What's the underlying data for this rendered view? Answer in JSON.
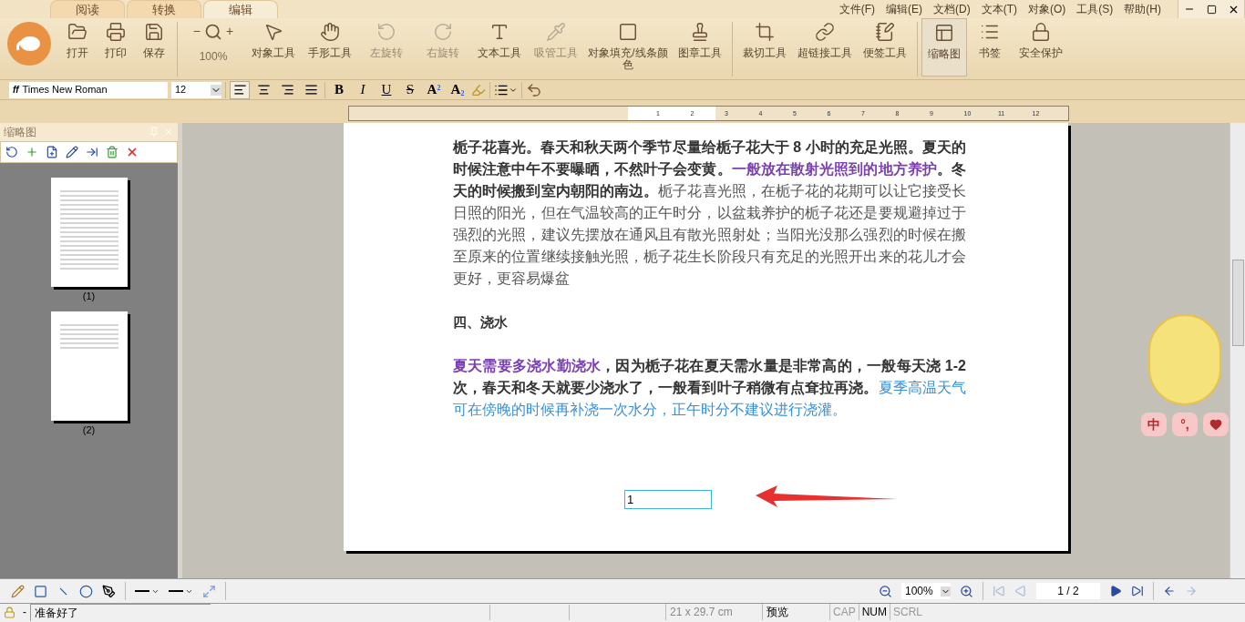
{
  "mode_tabs": [
    {
      "label": "阅读",
      "selected": false
    },
    {
      "label": "转换",
      "selected": false
    },
    {
      "label": "编辑",
      "selected": true
    }
  ],
  "menu": [
    "文件(F)",
    "编辑(E)",
    "文档(D)",
    "文本(T)",
    "对象(O)",
    "工具(S)",
    "帮助(H)"
  ],
  "toolbar": {
    "file_tools": [
      {
        "label": "打开"
      },
      {
        "label": "打印"
      },
      {
        "label": "保存"
      }
    ],
    "zoom": {
      "minus": "−",
      "plus": "+",
      "value": "100%"
    },
    "tools": [
      {
        "label": "对象工具",
        "disabled": false
      },
      {
        "label": "手形工具",
        "disabled": false
      },
      {
        "label": "左旋转",
        "disabled": true
      },
      {
        "label": "右旋转",
        "disabled": true
      },
      {
        "label": "文本工具",
        "disabled": false
      },
      {
        "label": "吸管工具",
        "disabled": true
      },
      {
        "label": "对象填充/线条颜色",
        "disabled": false
      },
      {
        "label": "图章工具",
        "disabled": false
      }
    ],
    "edit_tools": [
      {
        "label": "裁切工具"
      },
      {
        "label": "超链接工具"
      },
      {
        "label": "便签工具"
      }
    ],
    "view_tools": [
      {
        "label": "缩略图",
        "selected": true
      },
      {
        "label": "书签",
        "selected": false
      },
      {
        "label": "安全保护",
        "selected": false
      }
    ]
  },
  "format_bar": {
    "font_icon": "ff",
    "font": "Times New Roman",
    "size": "12",
    "align": [
      {
        "selected": true
      },
      {
        "selected": false
      },
      {
        "selected": false
      },
      {
        "selected": false
      }
    ],
    "bold": "B",
    "italic": "I",
    "underline": "U",
    "strike": "S",
    "superscript": "A",
    "super_mark": "2",
    "subscript": "A",
    "sub_mark": "2"
  },
  "ruler": [
    "1",
    "2",
    "3",
    "4",
    "5",
    "6",
    "7",
    "8",
    "9",
    "10",
    "11",
    "12"
  ],
  "sidebar": {
    "title": "缩略图",
    "pages": [
      {
        "label": "(1)",
        "selected": false
      },
      {
        "label": "(2)",
        "selected": false
      }
    ]
  },
  "document": {
    "paragraphs": [
      {
        "kind": "body",
        "segments": [
          {
            "kind": "bold",
            "text": "栀子花喜光。春天和秋天两个季节尽量给栀子花大于 8 小时的充足光照。夏天的时候注意中午不要曝晒，不然叶子会变黄。"
          },
          {
            "kind": "purple",
            "text": "一般放在散射光照到的地方养护"
          },
          {
            "kind": "bold",
            "text": "。冬天的时候搬到室内朝阳的南边。"
          },
          {
            "kind": "plain",
            "text": "栀子花喜光照，在栀子花的花期可以让它接受长日照的阳光，但在气温较高的正午时分，以盆栽养护的栀子花还是要规避掉过于强烈的光照，建议先摆放在通风且有散光照射处；当阳光没那么强烈的时候在搬至原来的位置继续接触光照，栀子花生长阶段只有充足的光照开出来的花儿才会更好，更容易爆盆"
          }
        ]
      },
      {
        "kind": "heading",
        "segments": [
          {
            "kind": "bold",
            "text": "四、浇水"
          }
        ]
      },
      {
        "kind": "body",
        "segments": [
          {
            "kind": "purple",
            "text": "夏天需要多浇水勤浇水"
          },
          {
            "kind": "bold",
            "text": "，因为栀子花在夏天需水量是非常高的，一般每天浇 1-2 次，春天和冬天就要少浇水了，一般看到叶子稍微有点耷拉再浇。"
          },
          {
            "kind": "blue",
            "text": "夏季高温天气可在傍晚的时候再补浇一次水分，正午时分不建议进行浇灌。"
          }
        ]
      }
    ],
    "text_box": "1"
  },
  "ime": {
    "buttons": [
      "中",
      "°,"
    ]
  },
  "navigation": {
    "zoom": "100%",
    "page": "1 / 2",
    "first_disabled": true,
    "prev_disabled": true,
    "forward_disabled": true
  },
  "status_bar": {
    "separator": "-",
    "message": "准备好了",
    "page_size": "21 x 29.7 cm",
    "mode": "预览",
    "keys": [
      {
        "label": "CAP",
        "on": false
      },
      {
        "label": "NUM",
        "on": true
      },
      {
        "label": "SCRL",
        "on": false
      }
    ]
  }
}
